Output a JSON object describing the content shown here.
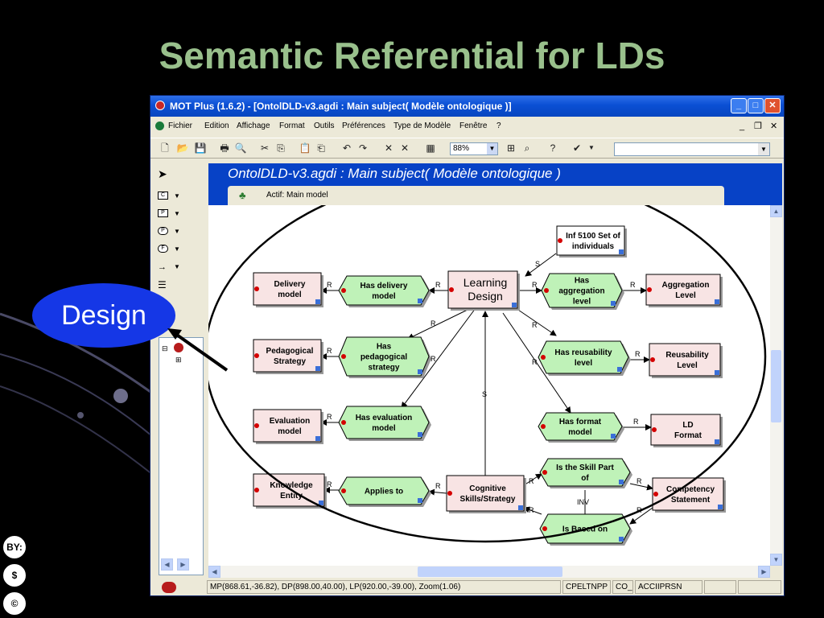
{
  "slide": {
    "title": "Semantic Referential for LDs",
    "callout": "Design"
  },
  "window": {
    "title": "MOT Plus (1.6.2) - [OntolDLD-v3.agdi : Main subject( Modèle ontologique )]",
    "menu": [
      "Fichier",
      "Edition",
      "Affichage",
      "Format",
      "Outils",
      "Préférences",
      "Type de Modèle",
      "Fenêtre",
      "?"
    ],
    "toolbar": {
      "zoom": "88%"
    },
    "document_title": "OntolDLD-v3.agdi : Main subject( Modèle ontologique )",
    "active_model": "Actif: Main model",
    "status": {
      "coords": "MP(868.61,-36.82), DP(898.00,40.00), LP(920.00,-39.00), Zoom(1.06)",
      "field1": "CPELTNPP",
      "field2": "CO_",
      "field3": "ACCIIPRSN"
    }
  },
  "diagram": {
    "rects": [
      {
        "id": "inf",
        "lines": [
          "Inf 5100 Set of",
          "individuals"
        ]
      },
      {
        "id": "delivery",
        "lines": [
          "Delivery",
          "model"
        ]
      },
      {
        "id": "learning",
        "lines": [
          "Learning",
          "Design"
        ]
      },
      {
        "id": "aggregation",
        "lines": [
          "Aggregation",
          "Level"
        ]
      },
      {
        "id": "pedagogical",
        "lines": [
          "Pedagogical",
          "Strategy"
        ]
      },
      {
        "id": "reusability",
        "lines": [
          "Reusability",
          "Level"
        ]
      },
      {
        "id": "evaluation",
        "lines": [
          "Evaluation",
          "model"
        ]
      },
      {
        "id": "ldformat",
        "lines": [
          "LD",
          "Format"
        ]
      },
      {
        "id": "knowledge",
        "lines": [
          "Knowledge",
          "Entity"
        ]
      },
      {
        "id": "cognitive",
        "lines": [
          "Cognitive",
          "Skills/Strategy"
        ]
      },
      {
        "id": "competency",
        "lines": [
          "Competency",
          "Statement"
        ]
      }
    ],
    "hexes": [
      {
        "id": "has-delivery",
        "lines": [
          "Has delivery",
          "model"
        ]
      },
      {
        "id": "has-aggregation",
        "lines": [
          "Has",
          "aggregation",
          "level"
        ]
      },
      {
        "id": "has-pedagogical",
        "lines": [
          "Has",
          "pedagogical",
          "strategy"
        ]
      },
      {
        "id": "has-reusability",
        "lines": [
          "Has reusability",
          "level"
        ]
      },
      {
        "id": "has-evaluation",
        "lines": [
          "Has evaluation",
          "model"
        ]
      },
      {
        "id": "has-format",
        "lines": [
          "Has format",
          "model"
        ]
      },
      {
        "id": "applies-to",
        "lines": [
          "Applies to"
        ]
      },
      {
        "id": "skill-part",
        "lines": [
          "Is the Skill Part",
          "of"
        ]
      },
      {
        "id": "based-on",
        "lines": [
          "Is Based on"
        ]
      }
    ],
    "link_labels": {
      "r": "R",
      "s": "S",
      "inv": "INV"
    }
  },
  "license_icons": [
    "BY:",
    "$",
    "©"
  ]
}
